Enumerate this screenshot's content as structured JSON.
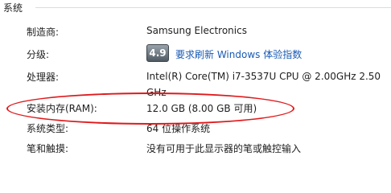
{
  "section": {
    "title": "系统"
  },
  "rows": [
    {
      "label": "制造商:",
      "value": "Samsung Electronics"
    },
    {
      "label": "分级:",
      "score": "4.9",
      "link": "要求刷新 Windows 体验指数"
    },
    {
      "label": "处理器:",
      "value": "Intel(R) Core(TM) i7-3537U CPU @ 2.00GHz   2.50 GHz"
    },
    {
      "label": "安装内存(RAM):",
      "value": "12.0 GB (8.00 GB 可用)"
    },
    {
      "label": "系统类型:",
      "value": "64 位操作系统"
    },
    {
      "label": "笔和触摸:",
      "value": "没有可用于此显示器的笔或触控输入"
    }
  ],
  "colors": {
    "link": "#1a5bb5",
    "highlight": "#e0191b",
    "divider": "#d5dfe5"
  }
}
